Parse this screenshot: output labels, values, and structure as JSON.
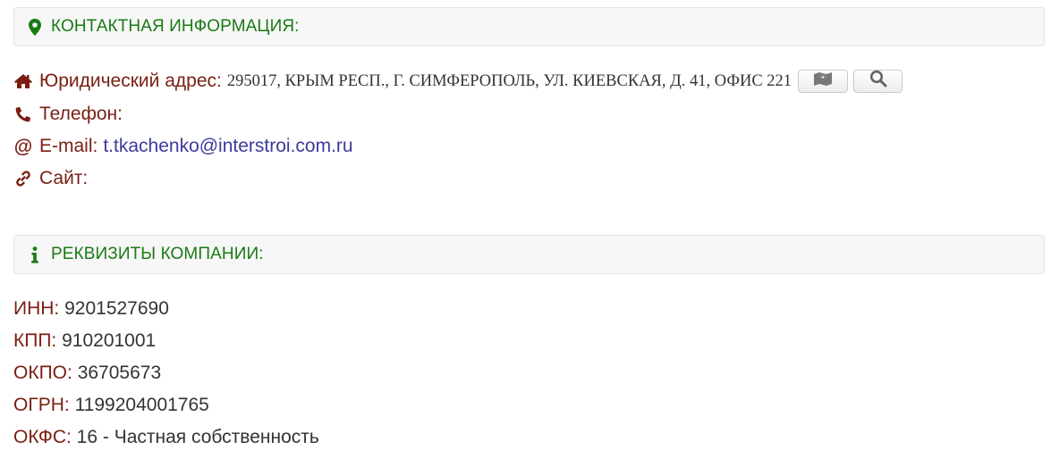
{
  "contact_panel": {
    "title": "КОНТАКТНАЯ ИНФОРМАЦИЯ:",
    "icon": "map-marker-icon"
  },
  "contact": {
    "address_label": "Юридический адрес:",
    "address_value": "295017, КРЫМ РЕСП., Г. СИМФЕРОПОЛЬ, УЛ. КИЕВСКАЯ, Д. 41, ОФИС 221",
    "phone_label": "Телефон:",
    "email_label": "E-mail:",
    "email_value": "t.tkachenko@interstroi.com.ru",
    "site_label": "Сайт:"
  },
  "details_panel": {
    "title": "РЕКВИЗИТЫ КОМПАНИИ:",
    "icon": "info-icon"
  },
  "details": [
    {
      "label": "ИНН:",
      "value": "9201527690"
    },
    {
      "label": "КПП:",
      "value": "910201001"
    },
    {
      "label": "ОКПО:",
      "value": "36705673"
    },
    {
      "label": "ОГРН:",
      "value": "1199204001765"
    },
    {
      "label": "ОКФС:",
      "value": "16 - Частная собственность"
    }
  ],
  "colors": {
    "panel_title": "#1a7a14",
    "label": "#7a1e12",
    "link": "#3c3a9c"
  }
}
